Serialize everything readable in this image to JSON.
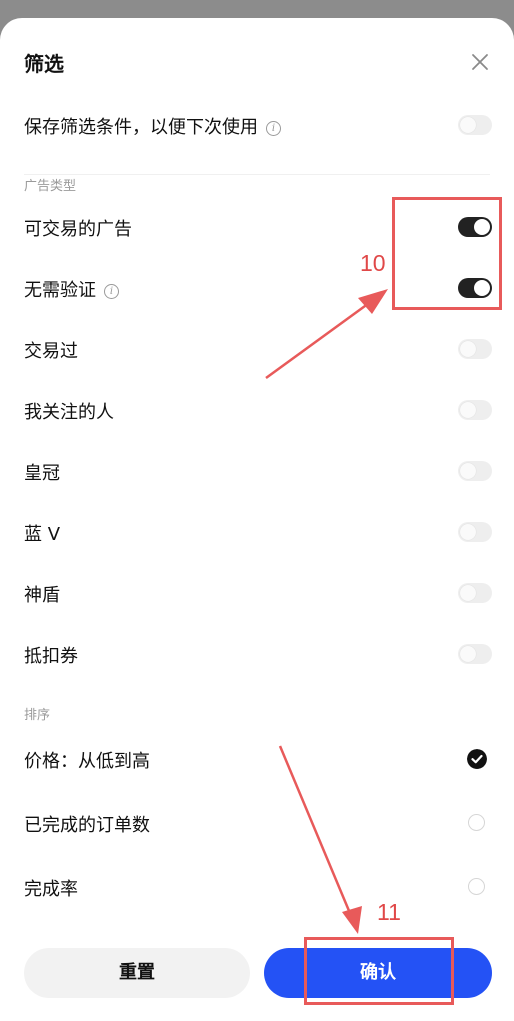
{
  "title": "筛选",
  "save_filter": {
    "label": "保存筛选条件，以便下次使用",
    "on": false
  },
  "sections": {
    "ad_type": "广告类型",
    "sort": "排序"
  },
  "ad_types": [
    {
      "label": "可交易的广告",
      "on": true,
      "info": false
    },
    {
      "label": "无需验证",
      "on": true,
      "info": true
    },
    {
      "label": "交易过",
      "on": false,
      "info": false
    },
    {
      "label": "我关注的人",
      "on": false,
      "info": false
    },
    {
      "label": "皇冠",
      "on": false,
      "info": false
    },
    {
      "label": "蓝 V",
      "on": false,
      "info": false
    },
    {
      "label": "神盾",
      "on": false,
      "info": false
    },
    {
      "label": "抵扣券",
      "on": false,
      "info": false
    }
  ],
  "sort_options": [
    {
      "label": "价格：从低到高",
      "selected": true
    },
    {
      "label": "已完成的订单数",
      "selected": false
    },
    {
      "label": "完成率",
      "selected": false
    }
  ],
  "buttons": {
    "reset": "重置",
    "confirm": "确认"
  },
  "annotations": {
    "step_a": "10",
    "step_b": "11",
    "color": "#e85a5a"
  },
  "icons": {
    "close": "close-icon",
    "info": "info-icon",
    "check": "check-circle-icon"
  }
}
